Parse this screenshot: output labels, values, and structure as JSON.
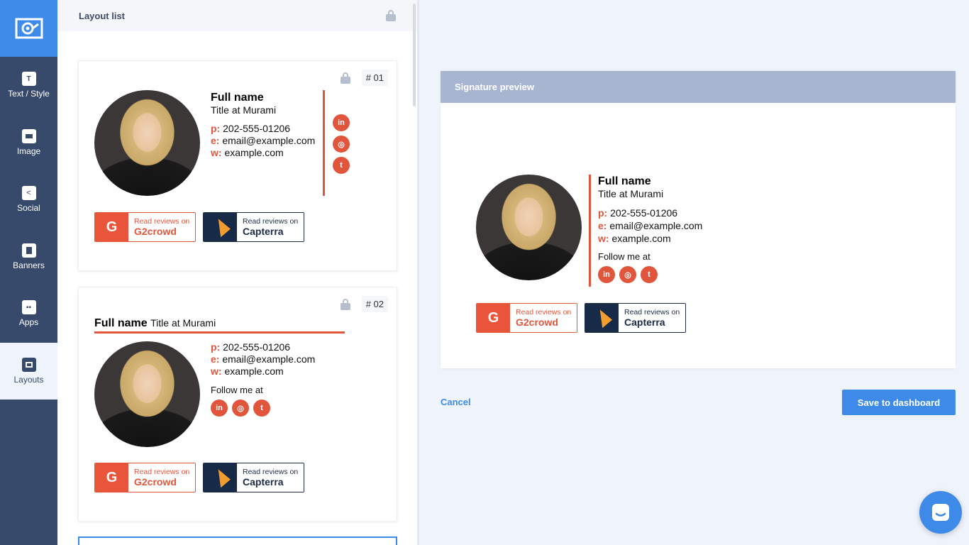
{
  "sidebar": {
    "items": [
      {
        "label": "Text / Style",
        "icon": "text-style-icon"
      },
      {
        "label": "Image",
        "icon": "image-icon"
      },
      {
        "label": "Social",
        "icon": "share-icon"
      },
      {
        "label": "Banners",
        "icon": "bookmark-icon"
      },
      {
        "label": "Apps",
        "icon": "grid-icon"
      },
      {
        "label": "Layouts",
        "icon": "layout-icon",
        "active": true
      }
    ]
  },
  "list": {
    "title": "Layout list",
    "cards": [
      {
        "number": "# 01"
      },
      {
        "number": "# 02"
      }
    ]
  },
  "signature": {
    "name": "Full name",
    "title": "Title at Murami",
    "phone_key": "p:",
    "phone": "202-555-01206",
    "email_key": "e:",
    "email": "email@example.com",
    "web_key": "w:",
    "web": "example.com",
    "follow": "Follow me at",
    "social": [
      "in",
      "ig",
      "tw"
    ]
  },
  "badges": {
    "g2": {
      "top": "Read reviews on",
      "name": "G2crowd",
      "mark": "G"
    },
    "capterra": {
      "top": "Read reviews on",
      "name": "Capterra"
    }
  },
  "preview": {
    "title": "Signature preview"
  },
  "actions": {
    "cancel": "Cancel",
    "save": "Save to dashboard"
  },
  "colors": {
    "accent": "#3d8ae8",
    "sidebar": "#384a6b",
    "signature_red": "#e2553d",
    "preview_header": "#a7b5d1"
  }
}
